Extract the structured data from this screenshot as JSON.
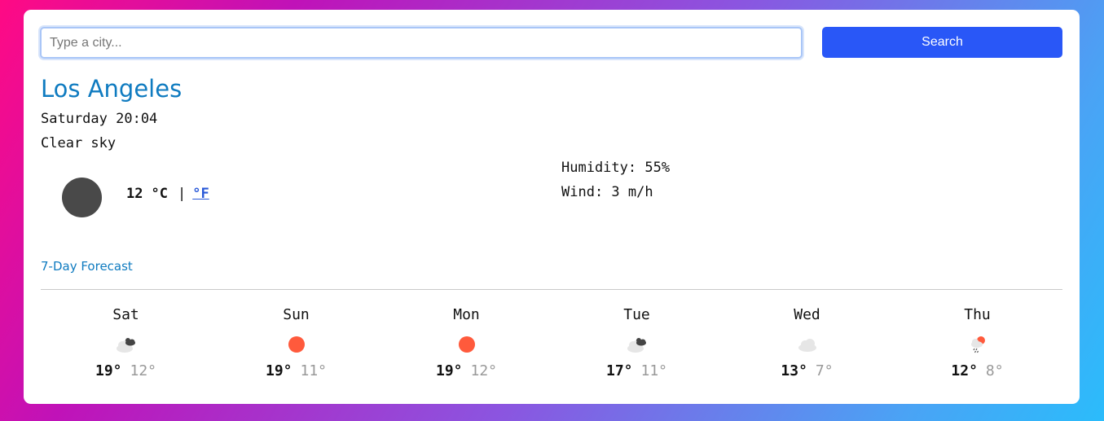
{
  "search": {
    "placeholder": "Type a city...",
    "value": "",
    "button_label": "Search"
  },
  "current": {
    "city": "Los Angeles",
    "datetime": "Saturday 20:04",
    "description": "Clear sky",
    "icon": "night-moon-icon",
    "temperature": "12",
    "unit_celsius": "°C",
    "separator": "|",
    "unit_fahrenheit": "°F",
    "humidity": "Humidity: 55%",
    "wind": "Wind: 3 m/h"
  },
  "forecast": {
    "title": "7-Day Forecast",
    "days": [
      {
        "name": "Sat",
        "icon": "broken-clouds-icon",
        "high": "19°",
        "low": "12°"
      },
      {
        "name": "Sun",
        "icon": "clear-sun-icon",
        "high": "19°",
        "low": "11°"
      },
      {
        "name": "Mon",
        "icon": "clear-sun-icon",
        "high": "19°",
        "low": "12°"
      },
      {
        "name": "Tue",
        "icon": "broken-clouds-icon",
        "high": "17°",
        "low": "11°"
      },
      {
        "name": "Wed",
        "icon": "cloud-icon",
        "high": "13°",
        "low": "7°"
      },
      {
        "name": "Thu",
        "icon": "rain-sun-icon",
        "high": "12°",
        "low": "8°"
      }
    ]
  },
  "colors": {
    "accent": "#0f7bc0",
    "button": "#2957f7",
    "sun": "#ff5a3c"
  }
}
